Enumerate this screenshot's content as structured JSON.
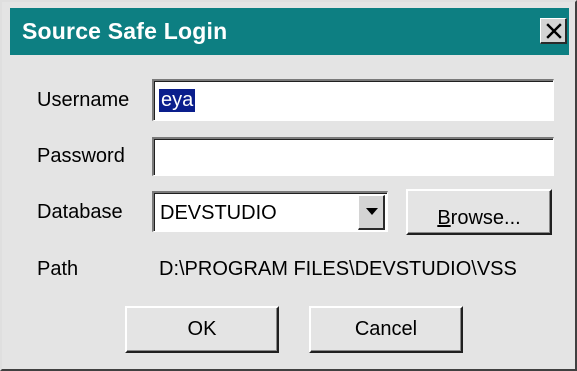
{
  "dialog": {
    "title": "Source Safe Login",
    "close_icon": "close-icon"
  },
  "form": {
    "username_label": "Username",
    "username_value": "eya",
    "password_label": "Password",
    "password_value": "",
    "database_label": "Database",
    "database_value": "DEVSTUDIO",
    "path_label": "Path",
    "path_value": "D:\\PROGRAM FILES\\DEVSTUDIO\\VSS"
  },
  "buttons": {
    "browse_prefix": "B",
    "browse_rest": "rowse...",
    "ok_label": "OK",
    "cancel_label": "Cancel"
  },
  "colors": {
    "title_bar": "#0d7f82",
    "dialog_face": "#e4e4e4",
    "selection": "#0a1e8c"
  }
}
